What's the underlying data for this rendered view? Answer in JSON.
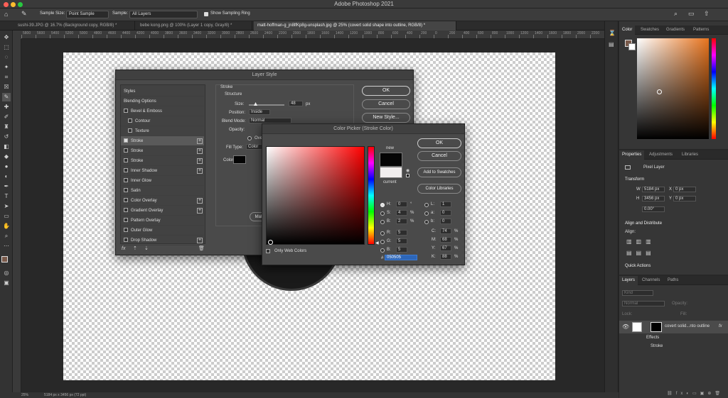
{
  "app": {
    "title": "Adobe Photoshop 2021"
  },
  "options": {
    "sample_size_label": "Sample Size:",
    "sample_size_value": "Point Sample",
    "sample_label": "Sample:",
    "sample_value": "All Layers",
    "sampling_ring_label": "Show Sampling Ring"
  },
  "tabs": [
    "sushi-39.JPG @ 16.7% (Background copy, RGB/8) *",
    "bebe kong.png @ 100% (Layer 1 copy, Gray/8) *",
    "matt-hoffman-g_jn8lfKp8g-unsplash.jpg @ 25% (covert solid shape into outline, RGB/8) *"
  ],
  "ruler_ticks": [
    "5800",
    "5600",
    "5400",
    "5200",
    "5000",
    "4800",
    "4600",
    "4400",
    "4200",
    "4000",
    "3800",
    "3600",
    "3400",
    "3200",
    "3000",
    "2800",
    "2600",
    "2400",
    "2200",
    "2000",
    "1800",
    "1600",
    "1400",
    "1200",
    "1000",
    "800",
    "600",
    "400",
    "200",
    "0",
    "200",
    "400",
    "600",
    "800",
    "1000",
    "1200",
    "1400",
    "1600",
    "1800",
    "2000",
    "2200",
    "2400",
    "2600",
    "2800",
    "3000",
    "3200",
    "3400",
    "3600",
    "3800",
    "4000",
    "4200",
    "4400",
    "4600",
    "4800",
    "5000",
    "5200",
    "5400",
    "5600",
    "5800",
    "6000",
    "6200",
    "6400",
    "6600",
    "6800",
    "7000",
    "7200",
    "7400",
    "7600",
    "7800",
    "8000",
    "8200",
    "8400",
    "8600",
    "8800",
    "9000",
    "9200",
    "9400",
    "9600",
    "9800",
    "10000",
    "10200",
    "10400",
    "10600",
    "10800",
    "11000"
  ],
  "status": {
    "zoom": "25%",
    "doc_size": "5184 px x 3456 px (72 ppi)"
  },
  "layer_style": {
    "title": "Layer Style",
    "styles_label": "Styles",
    "blending_label": "Blending Options",
    "items": [
      "Bevel & Emboss",
      "Contour",
      "Texture",
      "Stroke",
      "Stroke",
      "Stroke",
      "Inner Shadow",
      "Inner Glow",
      "Satin",
      "Color Overlay",
      "Gradient Overlay",
      "Pattern Overlay",
      "Outer Glow",
      "Drop Shadow"
    ],
    "stroke_title": "Stroke",
    "structure_title": "Structure",
    "size_label": "Size:",
    "size_value": "48",
    "size_unit": "px",
    "position_label": "Position:",
    "position_value": "Inside",
    "blend_label": "Blend Mode:",
    "blend_value": "Normal",
    "opacity_label": "Opacity:",
    "overprint_label": "Over",
    "filltype_label": "Fill Type:",
    "filltype_value": "Color",
    "color_label": "Color:",
    "make_default_label": "Make",
    "fx_label": "fx",
    "ok": "OK",
    "cancel": "Cancel",
    "new_style": "New Style..."
  },
  "color_picker": {
    "title": "Color Picker (Stroke Color)",
    "ok": "OK",
    "cancel": "Cancel",
    "add_swatches": "Add to Swatches",
    "color_libraries": "Color Libraries",
    "new_label": "new",
    "current_label": "current",
    "new_color": "#050505",
    "current_color": "#f1eeee",
    "only_web": "Only Web Colors",
    "fields": [
      {
        "k": "H:",
        "v": "0",
        "u": "°"
      },
      {
        "k": "S:",
        "v": "4",
        "u": "%"
      },
      {
        "k": "B:",
        "v": "2",
        "u": "%"
      },
      {
        "k": "R:",
        "v": "5",
        "u": ""
      },
      {
        "k": "G:",
        "v": "5",
        "u": ""
      },
      {
        "k": "B:",
        "v": "5",
        "u": ""
      }
    ],
    "lab": [
      {
        "k": "L:",
        "v": "1"
      },
      {
        "k": "a:",
        "v": "0"
      },
      {
        "k": "b:",
        "v": "0"
      }
    ],
    "cmyk": [
      {
        "k": "C:",
        "v": "74",
        "u": "%"
      },
      {
        "k": "M:",
        "v": "68",
        "u": "%"
      },
      {
        "k": "Y:",
        "v": "67",
        "u": "%"
      },
      {
        "k": "K:",
        "v": "88",
        "u": "%"
      }
    ],
    "hex_label": "#",
    "hex_value": "050505"
  },
  "color_panel": {
    "tabs": [
      "Color",
      "Swatches",
      "Gradients",
      "Patterns"
    ]
  },
  "properties": {
    "tabs": [
      "Properties",
      "Adjustments",
      "Libraries"
    ],
    "layer_type": "Pixel Layer",
    "transform": "Transform",
    "w_label": "W",
    "w_value": "5184 px",
    "h_label": "H",
    "h_value": "3456 px",
    "x_label": "X",
    "x_value": "0 px",
    "y_label": "Y",
    "y_value": "0 px",
    "angle_value": "0.00°",
    "align_title": "Align and Distribute",
    "align_label": "Align:",
    "quick": "Quick Actions"
  },
  "layers": {
    "tabs": [
      "Layers",
      "Channels",
      "Paths"
    ],
    "kind": "Kind",
    "mode": "Normal",
    "opacity_label": "Opacity:",
    "lock_label": "Lock:",
    "fill_label": "Fill:",
    "layer_name": "covert solid...nto outline",
    "fx": "fx",
    "effects": "Effects",
    "stroke": "Stroke"
  },
  "colors": {
    "accent": "#3d7bd3",
    "hex_highlight": "#2d66b8",
    "fg_swatch": "#7a5a4a"
  }
}
